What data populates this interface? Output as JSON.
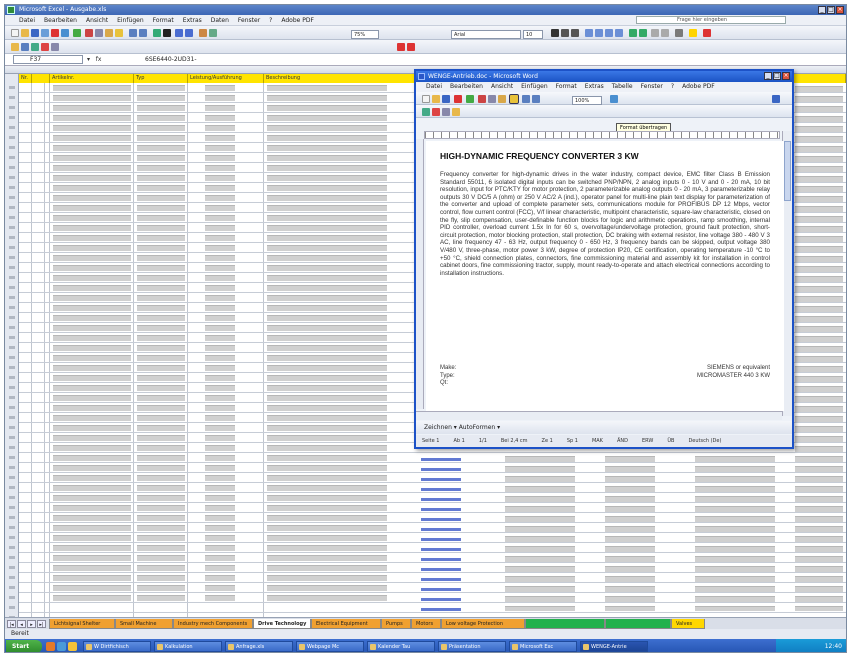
{
  "excel": {
    "title": "Microsoft Excel - Ausgabe.xls",
    "menu": [
      "Datei",
      "Bearbeiten",
      "Ansicht",
      "Einfügen",
      "Format",
      "Extras",
      "Daten",
      "Fenster",
      "?",
      "Adobe PDF"
    ],
    "help_placeholder": "Frage hier eingeben",
    "name_box": "F37",
    "formula_value": "6SE6440-2UD31-",
    "columns": [
      "Nr.",
      "",
      "Artikelnr.",
      "Typ",
      "Leistung/Ausführung",
      "Beschreibung"
    ],
    "sheet_tabs": [
      {
        "label": "Lichtsignal Shelter",
        "color": "#f0a030"
      },
      {
        "label": "Small Machine",
        "color": "#f0a030"
      },
      {
        "label": "Industry mech Components",
        "color": "#f0a030"
      },
      {
        "label": "Drive Technology",
        "color": "#ffffff"
      },
      {
        "label": "Electrical Equipment",
        "color": "#f0a030"
      },
      {
        "label": "Pumps",
        "color": "#f0a030"
      },
      {
        "label": "Motors",
        "color": "#f0a030"
      },
      {
        "label": "Low voltage Protection",
        "color": "#f0a030"
      },
      {
        "label": "",
        "color": "#22b14c"
      },
      {
        "label": "",
        "color": "#22b14c"
      },
      {
        "label": "Valves",
        "color": "#ffd700"
      }
    ],
    "status": "Bereit",
    "zoom": "75%"
  },
  "word": {
    "title": "WENGE-Antrieb.doc - Microsoft Word",
    "menu": [
      "Datei",
      "Bearbeiten",
      "Ansicht",
      "Einfügen",
      "Format",
      "Extras",
      "Tabelle",
      "Fenster",
      "?",
      "Adobe PDF"
    ],
    "tooltip": "Format übertragen",
    "heading": "HIGH-DYNAMIC FREQUENCY CONVERTER 3 KW",
    "body": "Frequency converter for high-dynamic drives in the water industry, compact device, EMC filter Class B Emission Standard 55011, 6 isolated digital inputs can be switched PNP/NPN, 2 analog inputs 0 - 10 V and 0 - 20 mA, 10 bit resolution, input for PTC/KTY for motor protection, 2 parameterizable analog outputs 0 - 20 mA, 3 parameterizable relay outputs 30 V DC/5 A (ohm) or 250 V AC/2 A (ind.), operator panel for multi-line plain text display for parameterization of the converter and upload of complete parameter sets, communications module for PROFIBUS DP 12 Mbps, vector control, flow current control (FCC), V/f linear characteristic, multipoint characteristic, square-law characteristic, closed on the fly, slip compensation, user-definable function blocks for logic and arithmetic operations, ramp smoothing, internal PID controller, overload current 1.5x In for 60 s, overvoltage/undervoltage protection, ground fault protection, short-circuit protection, motor blocking protection, stall protection, DC braking with external resistor, line voltage 380 - 480 V 3 AC, line frequency 47 - 63 Hz, output frequency 0 - 650 Hz, 3 frequency bands can be skipped, output voltage 380 V/480 V, three-phase, motor power 3 kW, degree of protection IP20, CE certification, operating temperature -10 °C to +50 °C, shield connection plates, connectors, fine commissioning material and assembly kit for installation in control cabinet doors, fine commissioning tractor, supply, mount ready-to-operate and attach electrical connections according to installation instructions.",
    "make_label": "Make:",
    "type_label": "Type:",
    "qty_label": "Qt:",
    "make_value": "SIEMENS or equivalent",
    "type_value": "MICROMASTER 440 3 KW",
    "drawbar_label": "Zeichnen ▾  AutoFormen ▾",
    "status": [
      "Seite 1",
      "Ab 1",
      "1/1",
      "Bei 2,4 cm",
      "Ze 1",
      "Sp 1",
      "MAK",
      "ÄND",
      "ERW",
      "ÜB",
      "Deutsch (De)"
    ]
  },
  "taskbar": {
    "start": "Start",
    "tasks": [
      "W Dirtfichisch",
      "Kalkulation",
      "Anfrage.xls",
      "Webpage Mc",
      "Kalender Tau",
      "Präsentation",
      "Microsoft Exc",
      "WENGE-Antrie"
    ],
    "clock": "12:40"
  }
}
